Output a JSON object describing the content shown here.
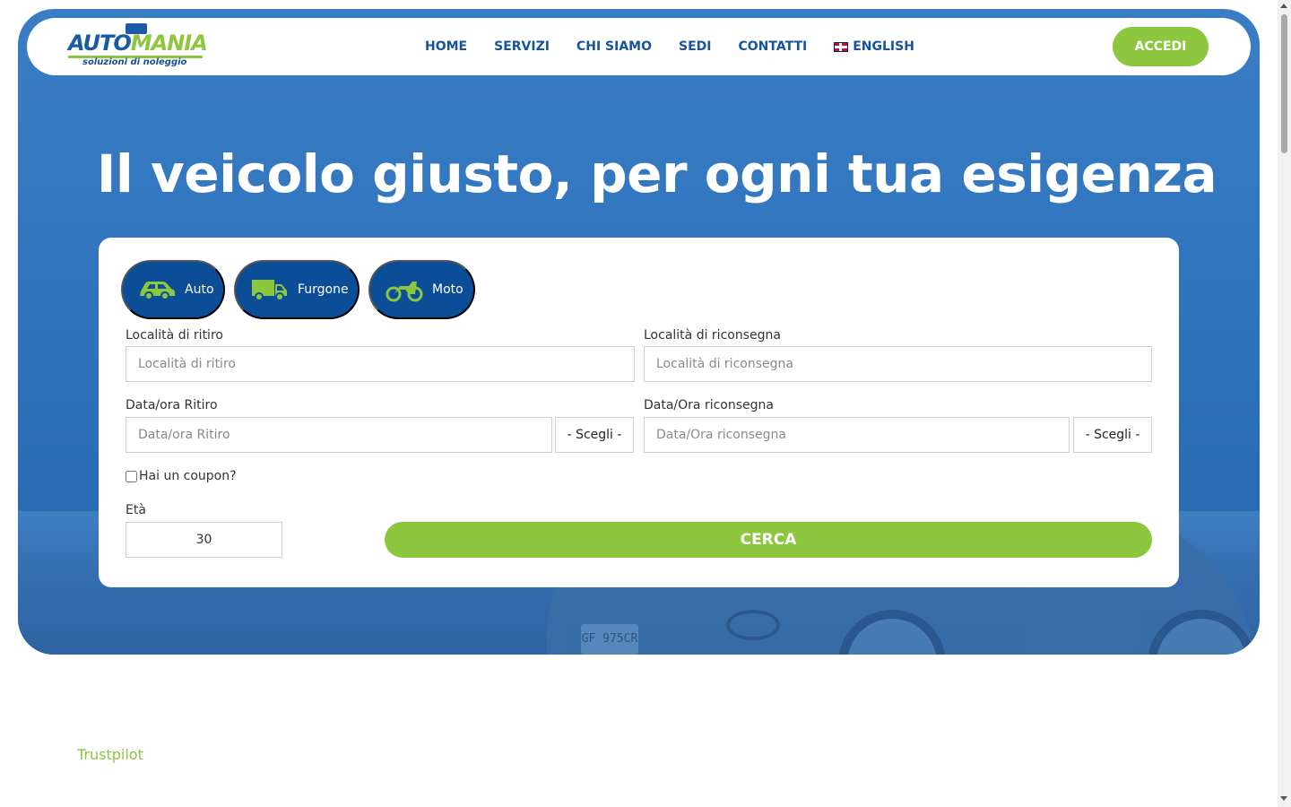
{
  "nav": {
    "logo": {
      "main_part1": "AUTO",
      "main_part2": "MANIA",
      "tagline": "soluzioni di noleggio"
    },
    "links": [
      "HOME",
      "SERVIZI",
      "CHI SIAMO",
      "SEDI",
      "CONTATTI"
    ],
    "language_label": "ENGLISH",
    "language_icon": "uk-flag-icon",
    "login_label": "ACCEDI"
  },
  "hero": {
    "title": "Il veicolo giusto, per ogni tua esigenza",
    "plate_text": "GF 975CR"
  },
  "search": {
    "tabs": [
      {
        "label": "Auto",
        "icon": "car-icon"
      },
      {
        "label": "Furgone",
        "icon": "van-icon"
      },
      {
        "label": "Moto",
        "icon": "motorbike-icon"
      }
    ],
    "pickup_location": {
      "label": "Località di ritiro",
      "placeholder": "Località di ritiro",
      "value": ""
    },
    "return_location": {
      "label": "Località di riconsegna",
      "placeholder": "Località di riconsegna",
      "value": ""
    },
    "pickup_datetime": {
      "label": "Data/ora Ritiro",
      "placeholder": "Data/ora Ritiro",
      "choose_label": "- Scegli -"
    },
    "return_datetime": {
      "label": "Data/Ora riconsegna",
      "placeholder": "Data/Ora riconsegna",
      "choose_label": "- Scegli -"
    },
    "coupon_label": "Hai un coupon?",
    "coupon_checked": false,
    "age": {
      "label": "Età",
      "value": "30"
    },
    "submit_label": "CERCA"
  },
  "footer": {
    "trustpilot_label": "Trustpilot"
  },
  "colors": {
    "primary": "#17549c",
    "accent": "#8dc63f",
    "hero": "#2f74bd",
    "tab": "#0b4e97"
  }
}
